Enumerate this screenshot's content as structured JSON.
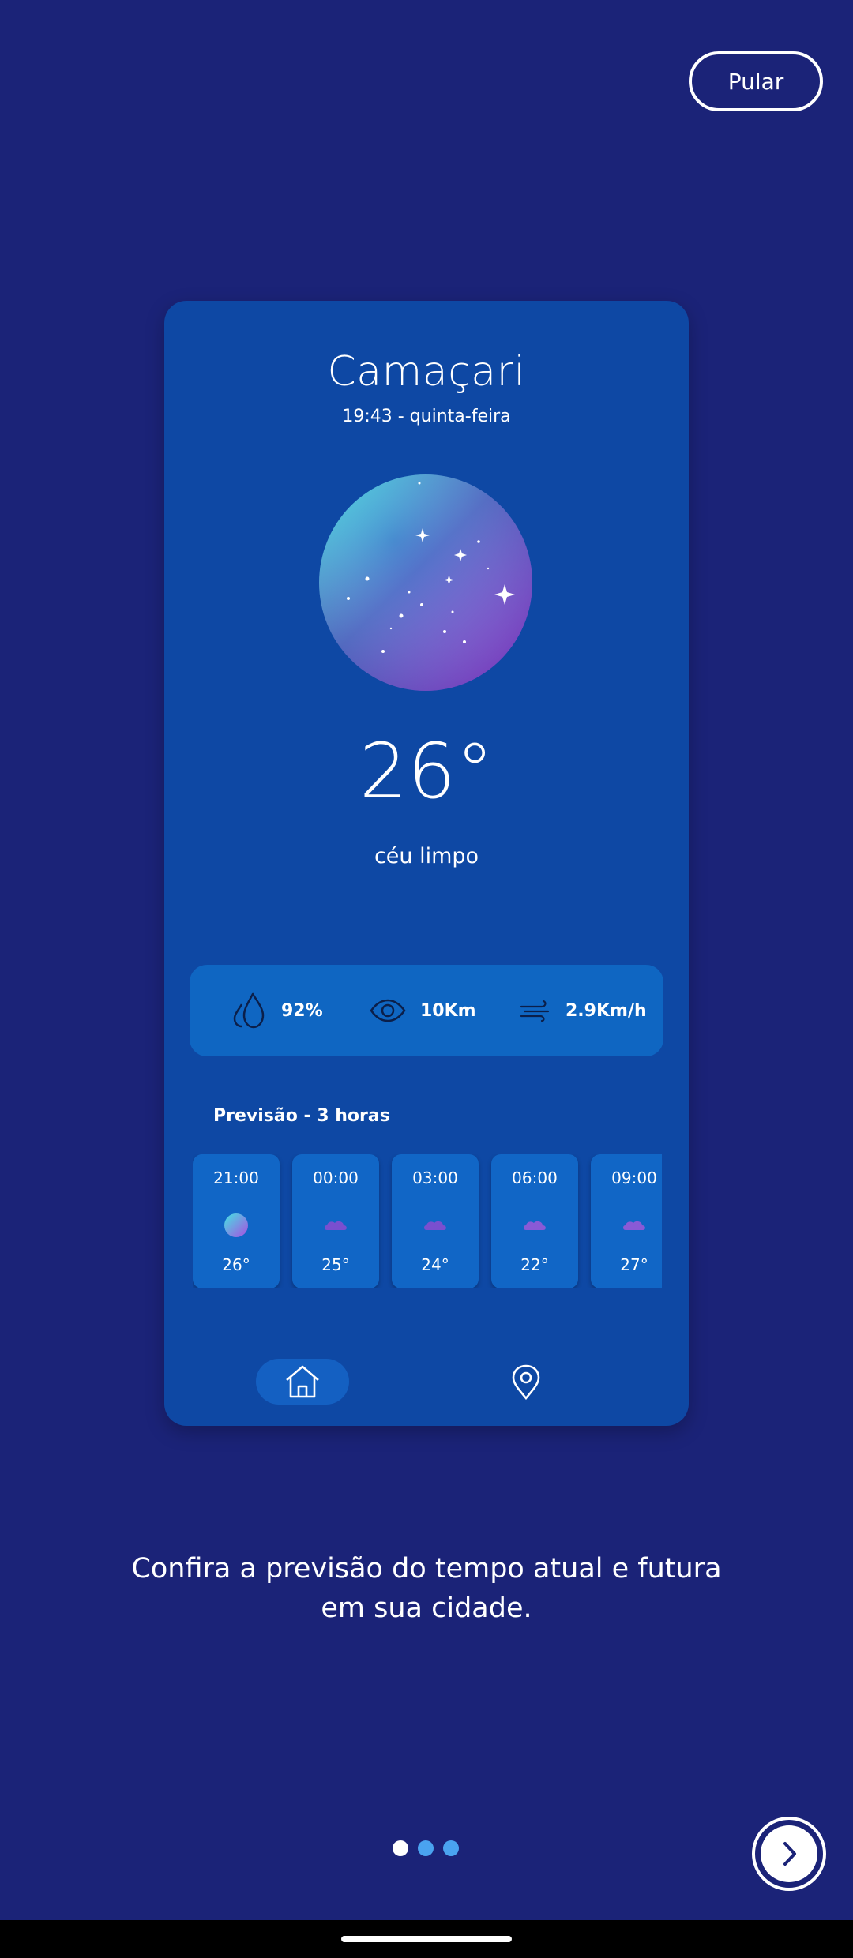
{
  "skip_label": "Pular",
  "card": {
    "city": "Camaçari",
    "datetime": "19:43 - quinta-feira",
    "temperature": "26°",
    "condition": "céu limpo",
    "condition_icon": "clear-night-orb",
    "stats": {
      "humidity": "92%",
      "visibility": "10Km",
      "wind": "2.9Km/h"
    },
    "forecast_title": "Previsão - 3 horas",
    "forecast": [
      {
        "time": "21:00",
        "temp": "26°",
        "icon": "night-orb-icon"
      },
      {
        "time": "00:00",
        "temp": "25°",
        "icon": "cloud-icon"
      },
      {
        "time": "03:00",
        "temp": "24°",
        "icon": "cloud-icon"
      },
      {
        "time": "06:00",
        "temp": "22°",
        "icon": "cloud-icon"
      },
      {
        "time": "09:00",
        "temp": "27°",
        "icon": "cloud-icon"
      }
    ]
  },
  "onboarding_text": "Confira a previsão do tempo atual e futura em sua cidade.",
  "pagination": {
    "total": 3,
    "active": 1
  },
  "colors": {
    "background": "#1b2378",
    "card": "#0e48a4",
    "panel": "#0f66c2",
    "dot_active": "#ffffff",
    "dot_inactive": "#4aa3f0"
  }
}
